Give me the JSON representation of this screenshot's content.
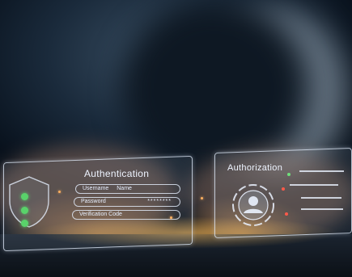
{
  "auth_panel": {
    "title": "Authentication",
    "fields": [
      {
        "label": "Username",
        "value": "Name"
      },
      {
        "label": "Password",
        "value": "********"
      },
      {
        "label": "Verification Code",
        "value": ""
      }
    ],
    "status_color": "#59d26a"
  },
  "authz_panel": {
    "title": "Authorization",
    "icon": "user-icon"
  },
  "colors": {
    "panel_stroke": "#e6f0ff",
    "glow": "#ffb060",
    "ok": "#59d26a",
    "alert": "#ff5a4a"
  }
}
